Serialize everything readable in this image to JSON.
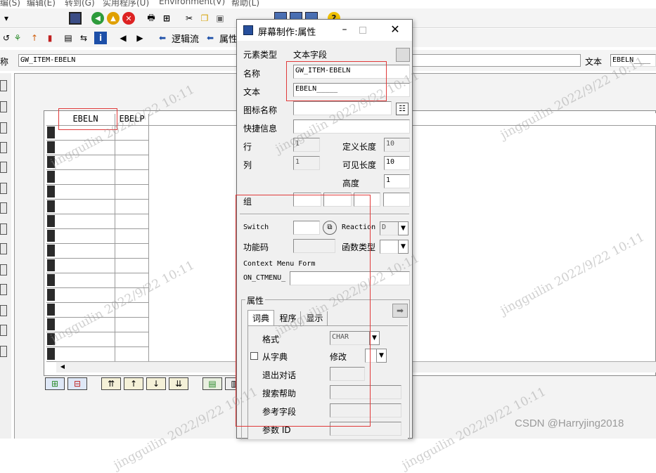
{
  "menu": [
    "编(S)",
    "编辑(E)",
    "转到(G)",
    "实用程序(U)",
    "Environment(V)",
    "帮助(L)"
  ],
  "toolbar2": {
    "logic_flow": "逻辑流",
    "attr": "属性"
  },
  "name_bar": {
    "left_label": "称",
    "value": "GW_ITEM-EBELN",
    "right_label": "文本",
    "right_value": "EBELN____"
  },
  "table": {
    "col1": "EBELN",
    "col2": "EBELP"
  },
  "dialog": {
    "title": "屏幕制作:属性",
    "element_type_label": "元素类型",
    "element_type_value": "文本字段",
    "name_label": "名称",
    "name_value": "GW_ITEM-EBELN",
    "text_label": "文本",
    "text_value": "EBELN_____",
    "icon_name_label": "图标名称",
    "quickinfo_label": "快捷信息",
    "line_label": "行",
    "line_value": "1",
    "def_len_label": "定义长度",
    "def_len_value": "10",
    "col_label": "列",
    "col_value": "1",
    "vis_len_label": "可见长度",
    "vis_len_value": "10",
    "height_label": "高度",
    "height_value": "1",
    "group_label": "组",
    "switch_label": "Switch",
    "reaction_label": "Reaction",
    "reaction_value": "D",
    "fcode_label": "功能码",
    "ftype_label": "函数类型",
    "ctx_label": "Context Menu Form",
    "ctx_prefix": "ON_CTMENU_",
    "attr_group_label": "属性",
    "tabs": [
      "词典",
      "程序",
      "显示"
    ],
    "format_label": "格式",
    "format_value": "CHAR",
    "from_dict_label": "从字典",
    "modify_label": "修改",
    "exit_label": "退出对话",
    "search_help_label": "搜索帮助",
    "ref_field_label": "参考字段",
    "param_id_label": "参数 ID"
  },
  "watermark": "jingguilin 2022/9/22 10:11",
  "csdn": "CSDN @Harryjing2018"
}
